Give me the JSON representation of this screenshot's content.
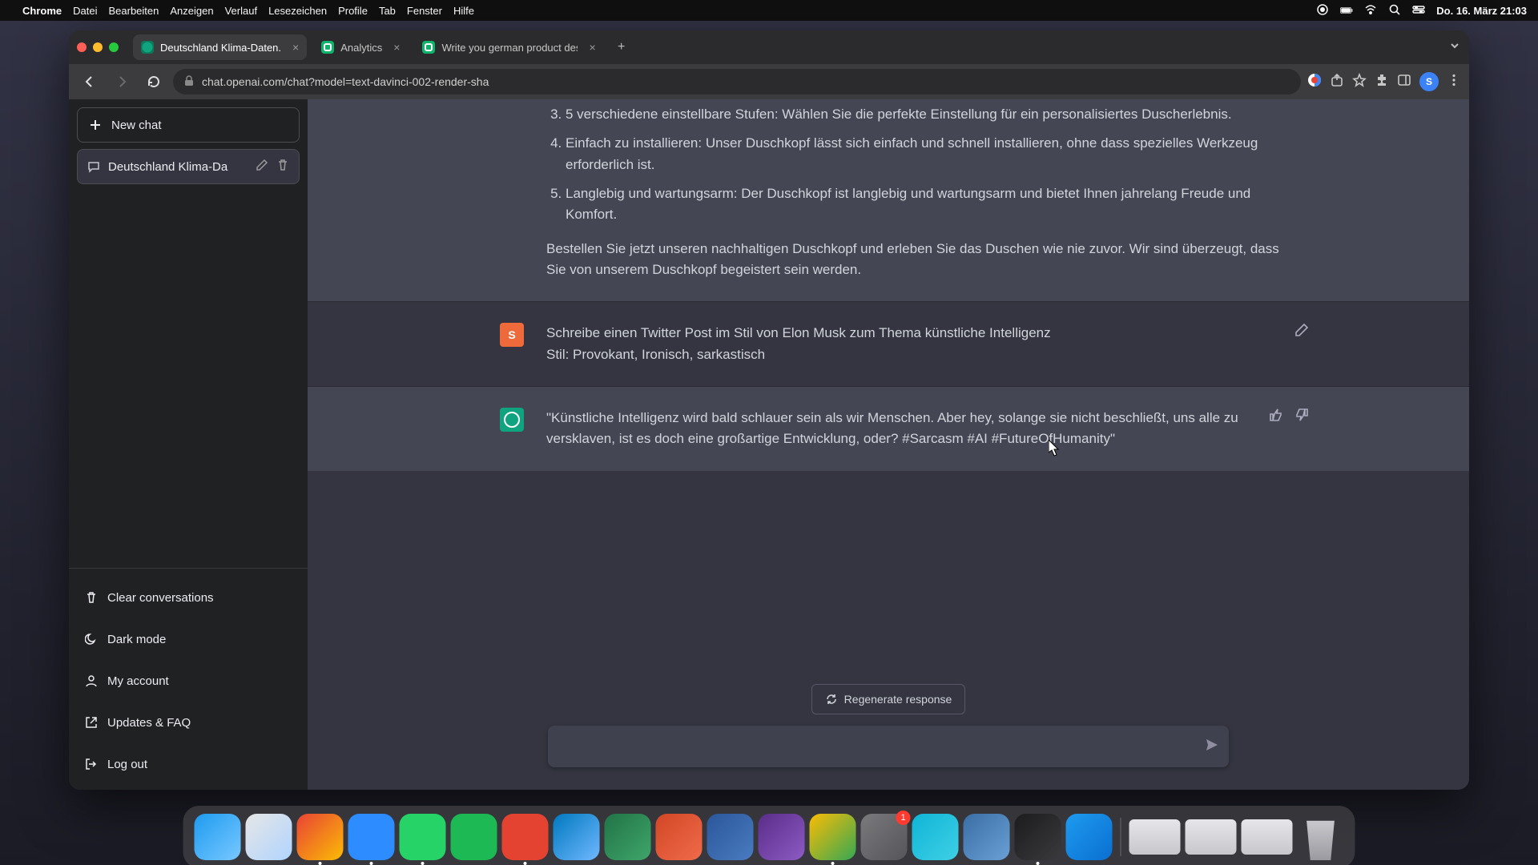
{
  "menubar": {
    "app_name": "Chrome",
    "items": [
      "Datei",
      "Bearbeiten",
      "Anzeigen",
      "Verlauf",
      "Lesezeichen",
      "Profile",
      "Tab",
      "Fenster",
      "Hilfe"
    ],
    "clock": "Do. 16. März  21:03",
    "battery_label": "100"
  },
  "tabs": [
    {
      "title": "Deutschland Klima-Daten.",
      "active": true,
      "favicon": "openai"
    },
    {
      "title": "Analytics",
      "active": false,
      "favicon": "green"
    },
    {
      "title": "Write you german product des",
      "active": false,
      "favicon": "green"
    }
  ],
  "omnibox": {
    "url": "chat.openai.com/chat?model=text-davinci-002-render-sha"
  },
  "profile_initial": "S",
  "sidebar": {
    "new_chat": "New chat",
    "conversation_title": "Deutschland Klima-Da",
    "footer": {
      "clear": "Clear conversations",
      "dark": "Dark mode",
      "account": "My account",
      "updates": "Updates & FAQ",
      "logout": "Log out"
    }
  },
  "chat": {
    "prev_assistant": {
      "list_start": 3,
      "items": [
        "5 verschiedene einstellbare Stufen: Wählen Sie die perfekte Einstellung für ein personalisiertes Duscherlebnis.",
        "Einfach zu installieren: Unser Duschkopf lässt sich einfach und schnell installieren, ohne dass spezielles Werkzeug erforderlich ist.",
        "Langlebig und wartungsarm: Der Duschkopf ist langlebig und wartungsarm und bietet Ihnen jahrelang Freude und Komfort."
      ],
      "closing": "Bestellen Sie jetzt unseren nachhaltigen Duschkopf und erleben Sie das Duschen wie nie zuvor. Wir sind überzeugt, dass Sie von unserem Duschkopf begeistert sein werden."
    },
    "user_initial": "S",
    "user_prompt_line1": "Schreibe einen Twitter Post im Stil von Elon Musk zum Thema künstliche Intelligenz",
    "user_prompt_line2": "Stil: Provokant, Ironisch, sarkastisch",
    "assistant_reply": "\"Künstliche Intelligenz wird bald schlauer sein als wir Menschen. Aber hey, solange sie nicht beschließt, uns alle zu versklaven, ist es doch eine großartige Entwicklung, oder? #Sarcasm #AI #FutureOfHumanity\""
  },
  "bottom": {
    "regenerate": "Regenerate response",
    "placeholder": ""
  },
  "dock": {
    "apps": [
      {
        "name": "finder",
        "color": [
          "#1e9bf0",
          "#78c8ff"
        ],
        "running": false
      },
      {
        "name": "safari",
        "color": [
          "#e6e6e6",
          "#b0d4ff"
        ],
        "running": false
      },
      {
        "name": "chrome",
        "color": [
          "#ea4335",
          "#fbbc05"
        ],
        "running": true
      },
      {
        "name": "zoom",
        "color": [
          "#2d8cff",
          "#2d8cff"
        ],
        "running": true
      },
      {
        "name": "whatsapp",
        "color": [
          "#25d366",
          "#25d366"
        ],
        "running": true
      },
      {
        "name": "spotify",
        "color": [
          "#1db954",
          "#1db954"
        ],
        "running": false
      },
      {
        "name": "todoist",
        "color": [
          "#e44332",
          "#e44332"
        ],
        "running": true
      },
      {
        "name": "trello",
        "color": [
          "#0079bf",
          "#70b8ff"
        ],
        "running": false
      },
      {
        "name": "excel",
        "color": [
          "#217346",
          "#3fa66a"
        ],
        "running": false
      },
      {
        "name": "powerpoint",
        "color": [
          "#d24726",
          "#f06b4a"
        ],
        "running": false
      },
      {
        "name": "word",
        "color": [
          "#2b579a",
          "#4a7bc0"
        ],
        "running": false
      },
      {
        "name": "imovie",
        "color": [
          "#5b2d89",
          "#8c5bc4"
        ],
        "running": false
      },
      {
        "name": "drive",
        "color": [
          "#fbbc05",
          "#34a853"
        ],
        "running": true
      },
      {
        "name": "settings",
        "color": [
          "#7a7a7d",
          "#55555a"
        ],
        "running": false,
        "badge": "1"
      },
      {
        "name": "siri",
        "color": [
          "#0fb5d6",
          "#3fd0e6"
        ],
        "running": false
      },
      {
        "name": "quicktime",
        "color": [
          "#3a6ea5",
          "#6aa0d6"
        ],
        "running": false
      },
      {
        "name": "voice-memos",
        "color": [
          "#1c1c1e",
          "#3a3a3c"
        ],
        "running": true
      },
      {
        "name": "app-store",
        "color": [
          "#1e9bf0",
          "#0a6fd0"
        ],
        "running": false
      }
    ],
    "right": [
      {
        "name": "window-preview-1"
      },
      {
        "name": "window-preview-2"
      },
      {
        "name": "window-preview-3"
      }
    ]
  }
}
